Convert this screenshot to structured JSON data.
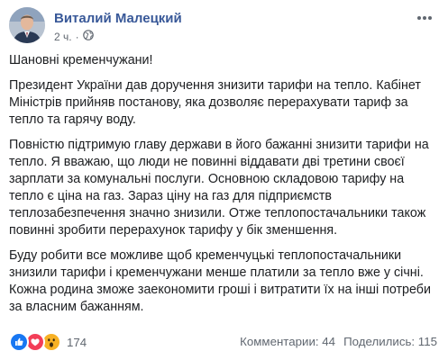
{
  "post": {
    "author": "Виталий Малецкий",
    "time": "2 ч.",
    "separator": "·",
    "privacy_icon": "globe-icon",
    "more_icon": "ellipsis-icon",
    "paragraphs": [
      "Шановні кременчужани!",
      "Президент України дав доручення знизити тарифи на тепло. Кабінет Міністрів прийняв постанову, яка дозволяє перерахувати тариф за тепло та гарячу воду.",
      "Повністю підтримую главу держави в його бажанні знизити тарифи на тепло. Я вважаю, що люди не повинні віддавати дві третини своєї зарплати за комунальні послуги. Основною складовою тарифу на тепло є ціна на газ. Зараз ціну на газ для підприємств теплозабезпечення значно знизили. Отже теплопостачальники також повинні зробити перерахунок тарифу у бік зменшення.",
      "Буду робити все можливе щоб кременчуцькі теплопостачальники знизили тарифи і кременчужани менше платили за тепло вже у січні. Кожна родина зможе заекономити гроші і витратити їх на інші потреби за власним бажанням."
    ]
  },
  "footer": {
    "reaction_icons": [
      "like-icon",
      "love-icon",
      "wow-icon"
    ],
    "reaction_count": "174",
    "comments": "Комментарии: 44",
    "shares": "Поделились: 115"
  },
  "colors": {
    "author": "#385898",
    "meta": "#606770",
    "like": "#1877f2",
    "love": "#f33e58",
    "wow": "#f7b125"
  }
}
